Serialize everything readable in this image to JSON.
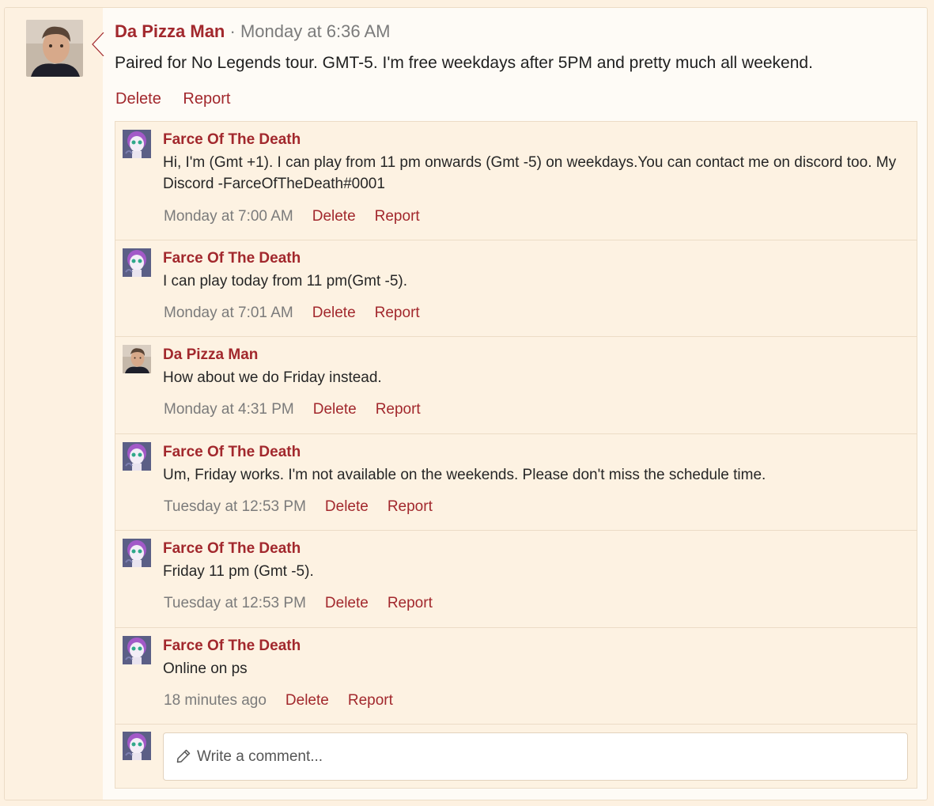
{
  "post": {
    "author": "Da Pizza Man",
    "separator": "·",
    "time": "Monday at 6:36 AM",
    "body": "Paired for No Legends tour. GMT-5. I'm free weekdays after 5PM and pretty much all weekend.",
    "delete_label": "Delete",
    "report_label": "Report",
    "avatar_icon": "user-photo-avatar"
  },
  "comments": [
    {
      "author": "Farce Of The Death",
      "text": "Hi, I'm (Gmt +1). I can play from 11 pm onwards (Gmt -5) on weekdays.You can contact me on discord too. My Discord -FarceOfTheDeath#0001",
      "time": "Monday at 7:00 AM",
      "delete_label": "Delete",
      "report_label": "Report",
      "avatar": "anime-avatar"
    },
    {
      "author": "Farce Of The Death",
      "text": "I can play today from 11 pm(Gmt -5).",
      "time": "Monday at 7:01 AM",
      "delete_label": "Delete",
      "report_label": "Report",
      "avatar": "anime-avatar"
    },
    {
      "author": "Da Pizza Man",
      "text": "How about we do Friday instead.",
      "time": "Monday at 4:31 PM",
      "delete_label": "Delete",
      "report_label": "Report",
      "avatar": "user-photo-avatar"
    },
    {
      "author": "Farce Of The Death",
      "text": "Um, Friday works. I'm not available on the weekends. Please don't miss the schedule time.",
      "time": "Tuesday at 12:53 PM",
      "delete_label": "Delete",
      "report_label": "Report",
      "avatar": "anime-avatar"
    },
    {
      "author": "Farce Of The Death",
      "text": "Friday 11 pm (Gmt -5).",
      "time": "Tuesday at 12:53 PM",
      "delete_label": "Delete",
      "report_label": "Report",
      "avatar": "anime-avatar"
    },
    {
      "author": "Farce Of The Death",
      "text": "Online on ps",
      "time": "18 minutes ago",
      "delete_label": "Delete",
      "report_label": "Report",
      "avatar": "anime-avatar"
    }
  ],
  "composer": {
    "placeholder": "Write a comment...",
    "icon": "pencil-icon"
  },
  "colors": {
    "link": "#a2282d",
    "meta": "#7b7b7b",
    "background": "#fdf1e1"
  }
}
